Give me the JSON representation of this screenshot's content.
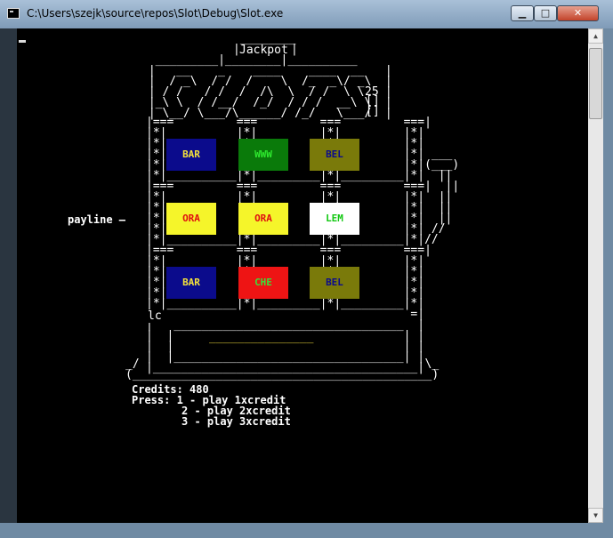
{
  "window": {
    "title": "C:\\Users\\szejk\\source\\repos\\Slot\\Debug\\Slot.exe",
    "min_label": "▁",
    "max_label": "□",
    "close_label": "✕"
  },
  "slot": {
    "jackpot_label": "Jackpot",
    "jackpot_value": "25",
    "payline_label": "payline —",
    "lc_label": "lc",
    "reels": [
      [
        {
          "text": "BAR",
          "bg": "#0b0b8c",
          "fg": "#f7e43a"
        },
        {
          "text": "WWW",
          "bg": "#0a7a0a",
          "fg": "#2ee82e"
        },
        {
          "text": "BEL",
          "bg": "#7a7a0a",
          "fg": "#0b0b8c"
        }
      ],
      [
        {
          "text": "ORA",
          "bg": "#f5f52a",
          "fg": "#e01010"
        },
        {
          "text": "ORA",
          "bg": "#f5f52a",
          "fg": "#e01010"
        },
        {
          "text": "LEM",
          "bg": "#ffffff",
          "fg": "#12c812"
        }
      ],
      [
        {
          "text": "BAR",
          "bg": "#0b0b8c",
          "fg": "#f7e43a"
        },
        {
          "text": "CHE",
          "bg": "#ee1414",
          "fg": "#39e039"
        },
        {
          "text": "BEL",
          "bg": "#7a7a0a",
          "fg": "#0b0b8c"
        }
      ]
    ]
  },
  "status": {
    "credits": "Credits: 480",
    "press": "Press: 1 - play 1xcredit",
    "opt2": "2 - play 2xcredit",
    "opt3": "3 - play 3xcredit"
  },
  "colors": {
    "console_bg": "#000000",
    "frame_accent": "#6f8aa3"
  }
}
